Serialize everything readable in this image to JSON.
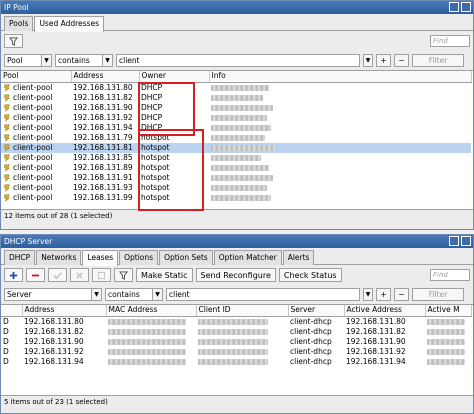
{
  "ippool": {
    "title": "IP Pool",
    "tabs": [
      "Pools",
      "Used Addresses"
    ],
    "filter_placeholder": "Find",
    "filter": {
      "field": "Pool",
      "op": "contains",
      "value": "client",
      "plus": "+",
      "minus": "−",
      "button": "Filter"
    },
    "columns": [
      "Pool",
      "Address",
      "Owner",
      "Info"
    ],
    "rows": [
      {
        "pool": "client-pool",
        "address": "192.168.131.80",
        "owner": "DHCP",
        "selected": false
      },
      {
        "pool": "client-pool",
        "address": "192.168.131.82",
        "owner": "DHCP",
        "selected": false
      },
      {
        "pool": "client-pool",
        "address": "192.168.131.90",
        "owner": "DHCP",
        "selected": false
      },
      {
        "pool": "client-pool",
        "address": "192.168.131.92",
        "owner": "DHCP",
        "selected": false
      },
      {
        "pool": "client-pool",
        "address": "192.168.131.94",
        "owner": "DHCP",
        "selected": false
      },
      {
        "pool": "client-pool",
        "address": "192.168.131.79",
        "owner": "hotspot",
        "selected": false
      },
      {
        "pool": "client-pool",
        "address": "192.168.131.81",
        "owner": "hotspot",
        "selected": true
      },
      {
        "pool": "client-pool",
        "address": "192.168.131.85",
        "owner": "hotspot",
        "selected": false
      },
      {
        "pool": "client-pool",
        "address": "192.168.131.89",
        "owner": "hotspot",
        "selected": false
      },
      {
        "pool": "client-pool",
        "address": "192.168.131.91",
        "owner": "hotspot",
        "selected": false
      },
      {
        "pool": "client-pool",
        "address": "192.168.131.93",
        "owner": "hotspot",
        "selected": false
      },
      {
        "pool": "client-pool",
        "address": "192.168.131.99",
        "owner": "hotspot",
        "selected": false
      }
    ],
    "status": "12 items out of 28 (1 selected)"
  },
  "dhcp": {
    "title": "DHCP Server",
    "tabs": [
      "DHCP",
      "Networks",
      "Leases",
      "Options",
      "Option Sets",
      "Option Matcher",
      "Alerts"
    ],
    "buttons": {
      "make_static": "Make Static",
      "send_reconfigure": "Send Reconfigure",
      "check_status": "Check Status"
    },
    "filter_placeholder": "Find",
    "filter": {
      "field": "Server",
      "op": "contains",
      "value": "client",
      "plus": "+",
      "minus": "−",
      "button": "Filter"
    },
    "columns": [
      "",
      "Address",
      "MAC Address",
      "Client ID",
      "Server",
      "Active Address",
      "Active M"
    ],
    "rows": [
      {
        "flag": "D",
        "address": "192.168.131.80",
        "server": "client-dhcp",
        "active": "192.168.131.80"
      },
      {
        "flag": "D",
        "address": "192.168.131.82",
        "server": "client-dhcp",
        "active": "192.168.131.82"
      },
      {
        "flag": "D",
        "address": "192.168.131.90",
        "server": "client-dhcp",
        "active": "192.168.131.90"
      },
      {
        "flag": "D",
        "address": "192.168.131.92",
        "server": "client-dhcp",
        "active": "192.168.131.92"
      },
      {
        "flag": "D",
        "address": "192.168.131.94",
        "server": "client-dhcp",
        "active": "192.168.131.94"
      }
    ],
    "status": "5 items out of 23 (1 selected)"
  },
  "colors": {
    "title_bar": "#3a68a8",
    "selection": "#b9d3f0",
    "highlight_box": "#d32020",
    "remove_red": "#c02020",
    "add_blue": "#1d4fa0"
  }
}
